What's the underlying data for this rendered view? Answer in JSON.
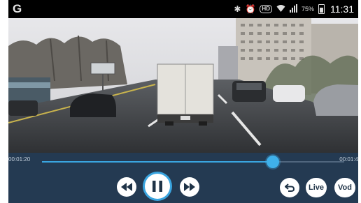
{
  "status_bar": {
    "app_logo": "G",
    "hd_label": "HD",
    "battery_percent": "75%",
    "time": "11:31"
  },
  "player": {
    "current_time": "00:01:20",
    "end_time": "00:01:4",
    "progress_fraction": 0.765,
    "controls": {
      "live_label": "Live",
      "vod_label": "Vod"
    }
  },
  "icons": {
    "status": [
      "bluetooth-icon",
      "alarm-icon",
      "hd-voice-icon",
      "wifi-icon",
      "signal-icon",
      "battery-icon"
    ],
    "player": [
      "rewind-icon",
      "pause-icon",
      "fast-forward-icon",
      "back-icon"
    ]
  },
  "colors": {
    "controls_background": "#243a52",
    "seek_accent": "#3aa5e0"
  }
}
